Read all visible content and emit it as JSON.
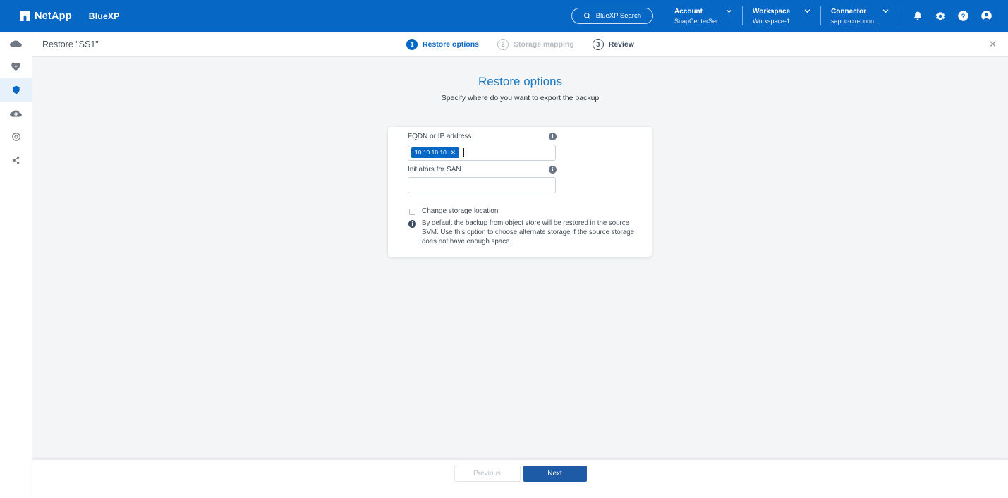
{
  "topbar": {
    "brand": "NetApp",
    "product": "BlueXP",
    "search_label": "BlueXP Search",
    "menus": [
      {
        "label": "Account",
        "value": "SnapCenterSer..."
      },
      {
        "label": "Workspace",
        "value": "Workspace-1"
      },
      {
        "label": "Connector",
        "value": "sapcc-cm-conn..."
      }
    ],
    "icons": [
      "notifications-bell-icon",
      "settings-gear-icon",
      "help-icon",
      "user-icon"
    ]
  },
  "sidebar": {
    "items": [
      {
        "icon": "cloud-icon",
        "active": false
      },
      {
        "icon": "health-heart-icon",
        "active": false
      },
      {
        "icon": "protection-shield-icon",
        "active": true
      },
      {
        "icon": "cloud-observability-icon",
        "active": false
      },
      {
        "icon": "ring-icon",
        "active": false
      },
      {
        "icon": "share-nodes-icon",
        "active": false
      }
    ]
  },
  "wizard_header": {
    "title": "Restore \"SS1\"",
    "steps": [
      {
        "number": "1",
        "label": "Restore options",
        "state": "active"
      },
      {
        "number": "2",
        "label": "Storage mapping",
        "state": "upcoming"
      },
      {
        "number": "3",
        "label": "Review",
        "state": "upcoming-dark"
      }
    ],
    "close_label": "✕"
  },
  "main": {
    "title": "Restore options",
    "subtitle": "Specify where do you want to export the backup",
    "form": {
      "fqdn": {
        "label": "FQDN or IP address",
        "chip": "10.10.10.10",
        "chip_remove": "✕",
        "info_icon": "info-icon"
      },
      "initiators": {
        "label": "Initiators for SAN",
        "value": "",
        "info_icon": "info-icon"
      },
      "checkbox": {
        "label": "Change storage location",
        "checked": false
      },
      "info_note": "By default the backup from object store will be restored in the source SVM. Use this option to choose alternate storage if the source storage does not have enough space."
    }
  },
  "footer": {
    "previous_label": "Previous",
    "next_label": "Next"
  },
  "colors": {
    "topbar_bg": "#0667C5",
    "accent_blue": "#0667C5",
    "main_title_blue": "#1E7BC4",
    "next_button_blue": "#1E5BA6",
    "content_bg": "#F4F5F6",
    "chip_bg": "#0667C5",
    "step_upcoming_gray": "#B6BDC5",
    "step_upcoming_dark": "#3E4D63"
  }
}
